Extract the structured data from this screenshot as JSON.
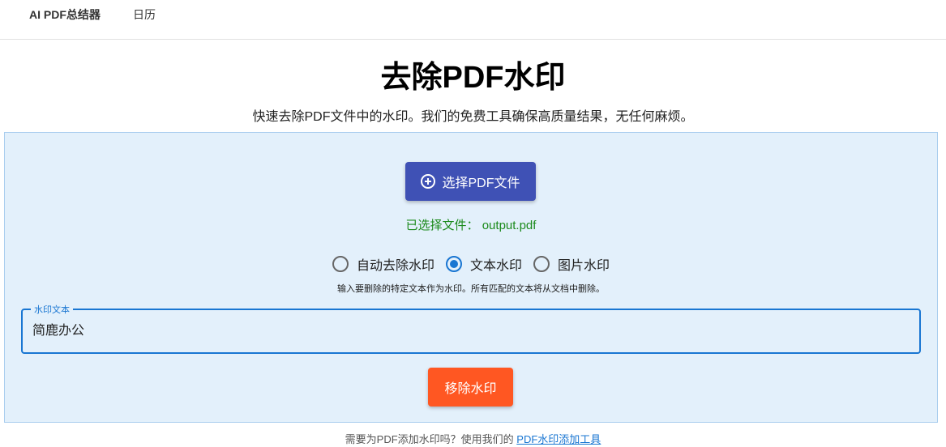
{
  "nav": {
    "items": [
      "AI PDF总结器",
      "日历"
    ]
  },
  "title": "去除PDF水印",
  "subtitle": "快速去除PDF文件中的水印。我们的免费工具确保高质量结果，无任何麻烦。",
  "upload": {
    "label": "选择PDF文件",
    "icon": "plus-circle-icon"
  },
  "selected": "已选择文件：  output.pdf",
  "modes": [
    {
      "label": "自动去除水印",
      "checked": false
    },
    {
      "label": "文本水印",
      "checked": true
    },
    {
      "label": "图片水印",
      "checked": false
    }
  ],
  "hint": "输入要删除的特定文本作为水印。所有匹配的文本将从文档中删除。",
  "field": {
    "label": "水印文本",
    "value": "简鹿办公"
  },
  "submit": "移除水印",
  "footer": {
    "text": "需要为PDF添加水印吗？使用我们的 ",
    "link": "PDF水印添加工具"
  },
  "colors": {
    "primary": "#3f51b5",
    "accent": "#ff5722",
    "blue": "#1976d2"
  }
}
